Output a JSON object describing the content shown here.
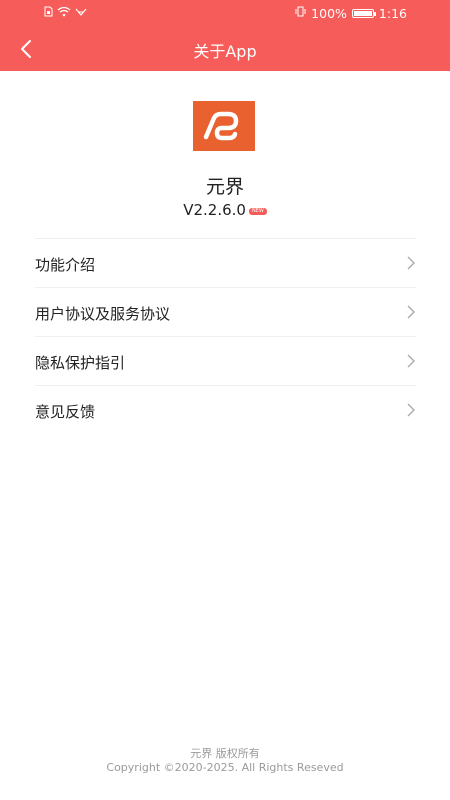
{
  "status_bar": {
    "left_icons": [
      "sim-icon",
      "wifi-icon",
      "signal-icon"
    ],
    "battery_percent": "100%",
    "time": "1:16"
  },
  "nav": {
    "back_icon": "chevron-left-icon",
    "title": "关于App"
  },
  "app": {
    "logo_icon": "app-logo-icon",
    "name": "元界",
    "version": "V2.2.6.0",
    "badge": "NEW"
  },
  "menu": {
    "items": [
      {
        "label": "功能介绍",
        "icon": "chevron-right-icon"
      },
      {
        "label": "用户协议及服务协议",
        "icon": "chevron-right-icon"
      },
      {
        "label": "隐私保护指引",
        "icon": "chevron-right-icon"
      },
      {
        "label": "意见反馈",
        "icon": "chevron-right-icon"
      }
    ]
  },
  "footer": {
    "owner": "元界 版权所有",
    "copyright": "Copyright ©2020-2025. All Rights Reseved"
  },
  "colors": {
    "header": "#f65d5a",
    "logo_bg": "#e8612f",
    "footer_text": "#9a9a9a"
  }
}
